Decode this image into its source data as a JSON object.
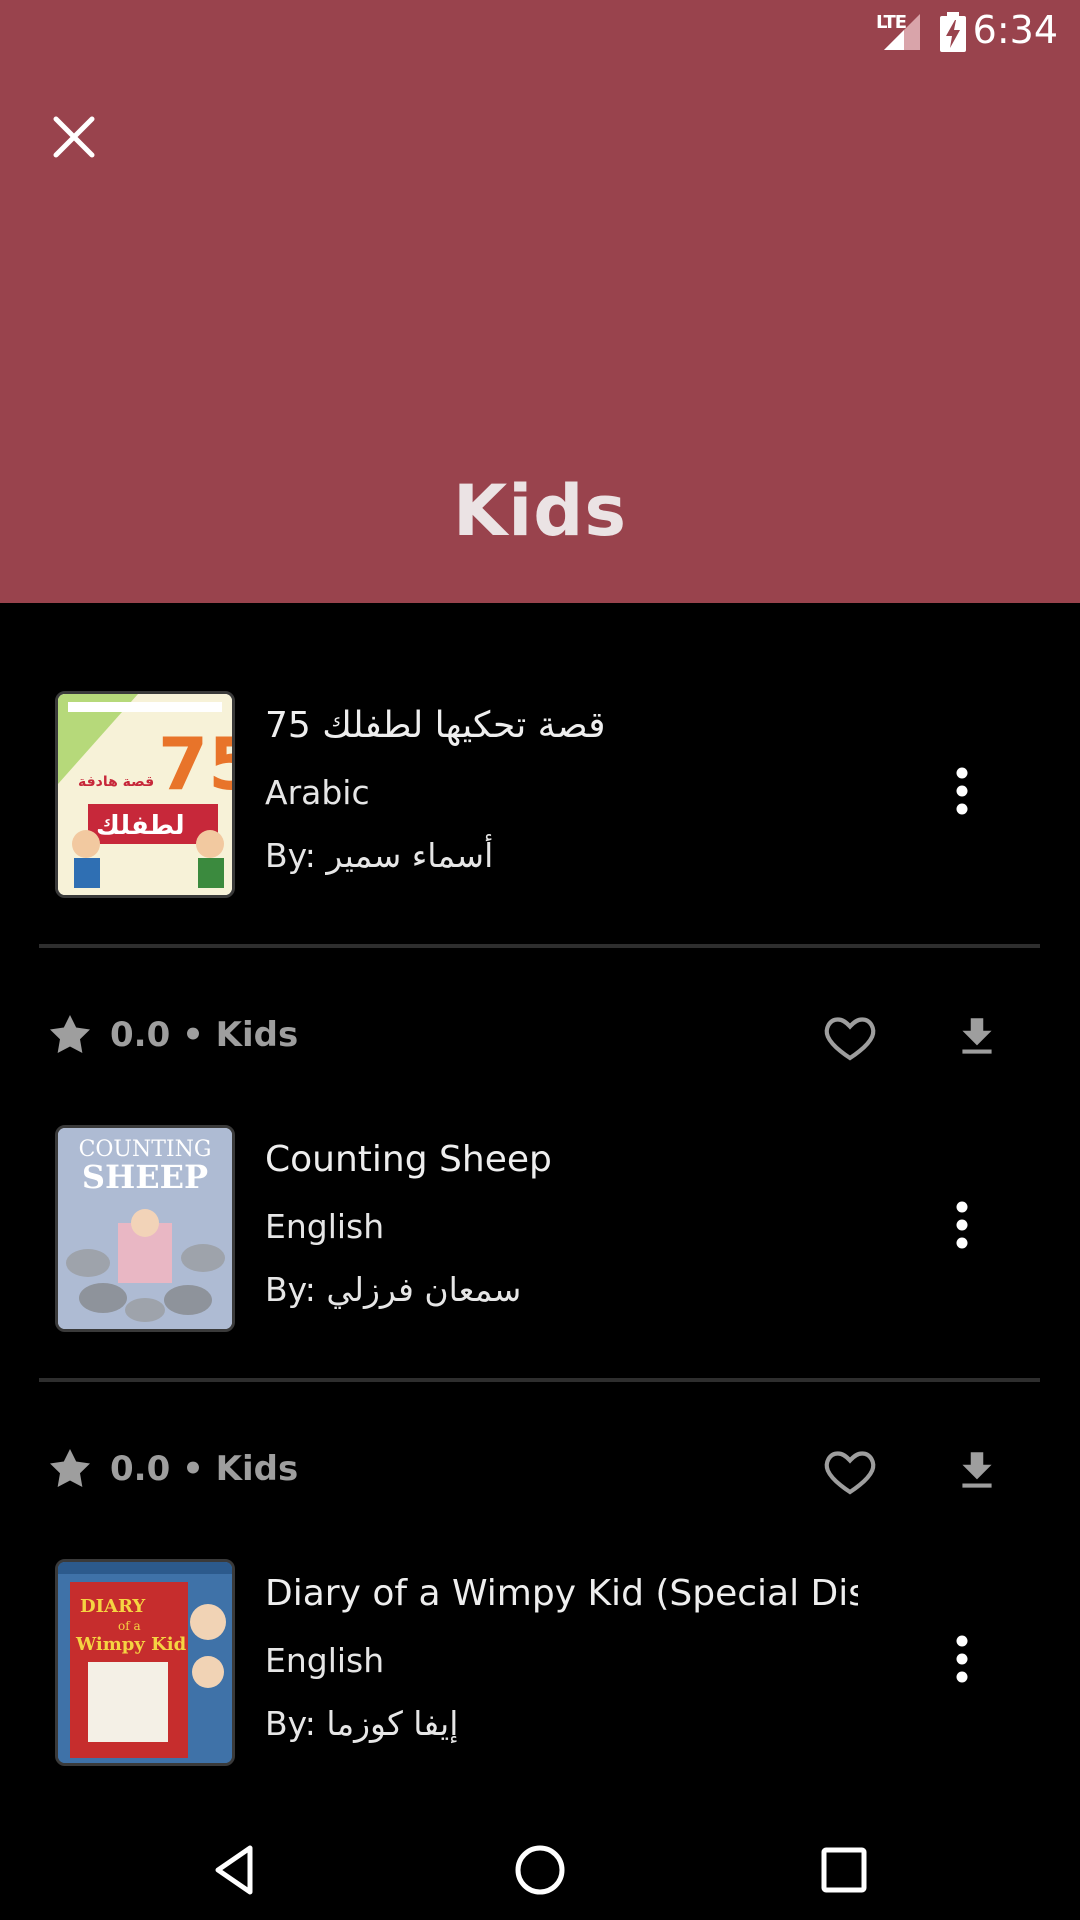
{
  "status_bar": {
    "network": "LTE",
    "time": "6:34"
  },
  "header": {
    "title": "Kids",
    "background_color": "#99434d",
    "close_icon": "close-icon"
  },
  "books": [
    {
      "title": "75 قصة تحكيها لطفلك",
      "language": "Arabic",
      "author": "By: أسماء سمير",
      "cover_text_number": "75",
      "cover_text_main": "لطفلك",
      "cover_text_sub": "قصة هادفة"
    },
    {
      "title": "Counting Sheep",
      "language": "English",
      "author": "By: سمعان فرزلي",
      "cover_text_line1": "COUNTING",
      "cover_text_line2": "SHEEP"
    },
    {
      "title": "Diary of a Wimpy Kid (Special Disney Edition)",
      "language": "English",
      "author": "By: إيفا كوزما",
      "cover_text_line1": "DIARY",
      "cover_text_line2": "of a",
      "cover_text_line3": "Wimpy Kid"
    }
  ],
  "meta_rows": [
    {
      "rating": "0.0",
      "separator": "•",
      "category": "Kids"
    },
    {
      "rating": "0.0",
      "separator": "•",
      "category": "Kids"
    }
  ],
  "icons": {
    "star": "star-icon",
    "heart": "heart-outline-icon",
    "download": "download-icon",
    "menu": "more-vertical-icon"
  },
  "nav": {
    "back": "back-icon",
    "home": "home-icon",
    "recents": "recents-icon"
  }
}
